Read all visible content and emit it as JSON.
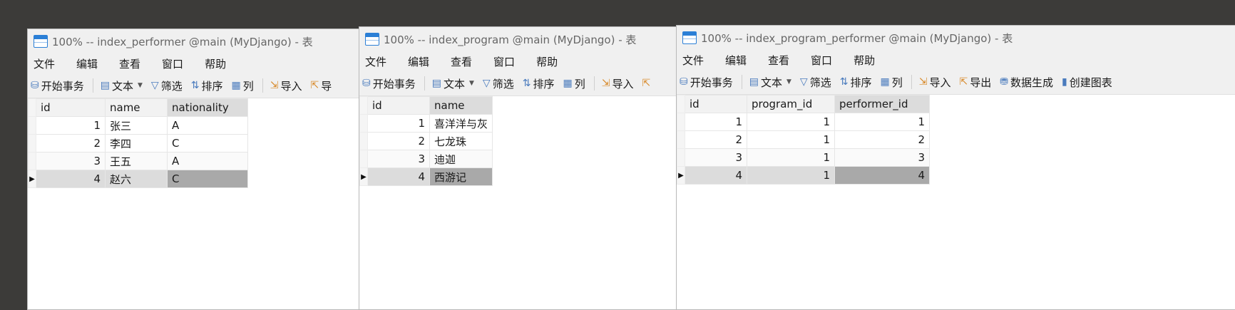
{
  "windows": [
    {
      "title": "100% -- index_performer @main (MyDjango) - 表",
      "menu": [
        "文件",
        "编辑",
        "查看",
        "窗口",
        "帮助"
      ],
      "toolbar": {
        "begin": "开始事务",
        "text": "文本",
        "filter": "筛选",
        "sort": "排序",
        "columns": "列",
        "import": "导入",
        "export_partial": "导"
      },
      "columns": [
        "id",
        "name",
        "nationality"
      ],
      "rows": [
        [
          "1",
          "张三",
          "A"
        ],
        [
          "2",
          "李四",
          "C"
        ],
        [
          "3",
          "王五",
          "A"
        ],
        [
          "4",
          "赵六",
          "C"
        ]
      ]
    },
    {
      "title": "100% -- index_program @main (MyDjango) - 表",
      "menu": [
        "文件",
        "编辑",
        "查看",
        "窗口",
        "帮助"
      ],
      "toolbar": {
        "begin": "开始事务",
        "text": "文本",
        "filter": "筛选",
        "sort": "排序",
        "columns": "列",
        "import": "导入"
      },
      "columns": [
        "id",
        "name"
      ],
      "rows": [
        [
          "1",
          "喜洋洋与灰"
        ],
        [
          "2",
          "七龙珠"
        ],
        [
          "3",
          "迪迦"
        ],
        [
          "4",
          "西游记"
        ]
      ]
    },
    {
      "title": "100% -- index_program_performer @main (MyDjango) - 表",
      "menu": [
        "文件",
        "编辑",
        "查看",
        "窗口",
        "帮助"
      ],
      "toolbar": {
        "begin": "开始事务",
        "text": "文本",
        "filter": "筛选",
        "sort": "排序",
        "columns": "列",
        "import": "导入",
        "export": "导出",
        "generate": "数据生成",
        "chart": "创建图表"
      },
      "columns": [
        "id",
        "program_id",
        "performer_id"
      ],
      "rows": [
        [
          "1",
          "1",
          "1"
        ],
        [
          "2",
          "1",
          "2"
        ],
        [
          "3",
          "1",
          "3"
        ],
        [
          "4",
          "1",
          "4"
        ]
      ]
    }
  ]
}
